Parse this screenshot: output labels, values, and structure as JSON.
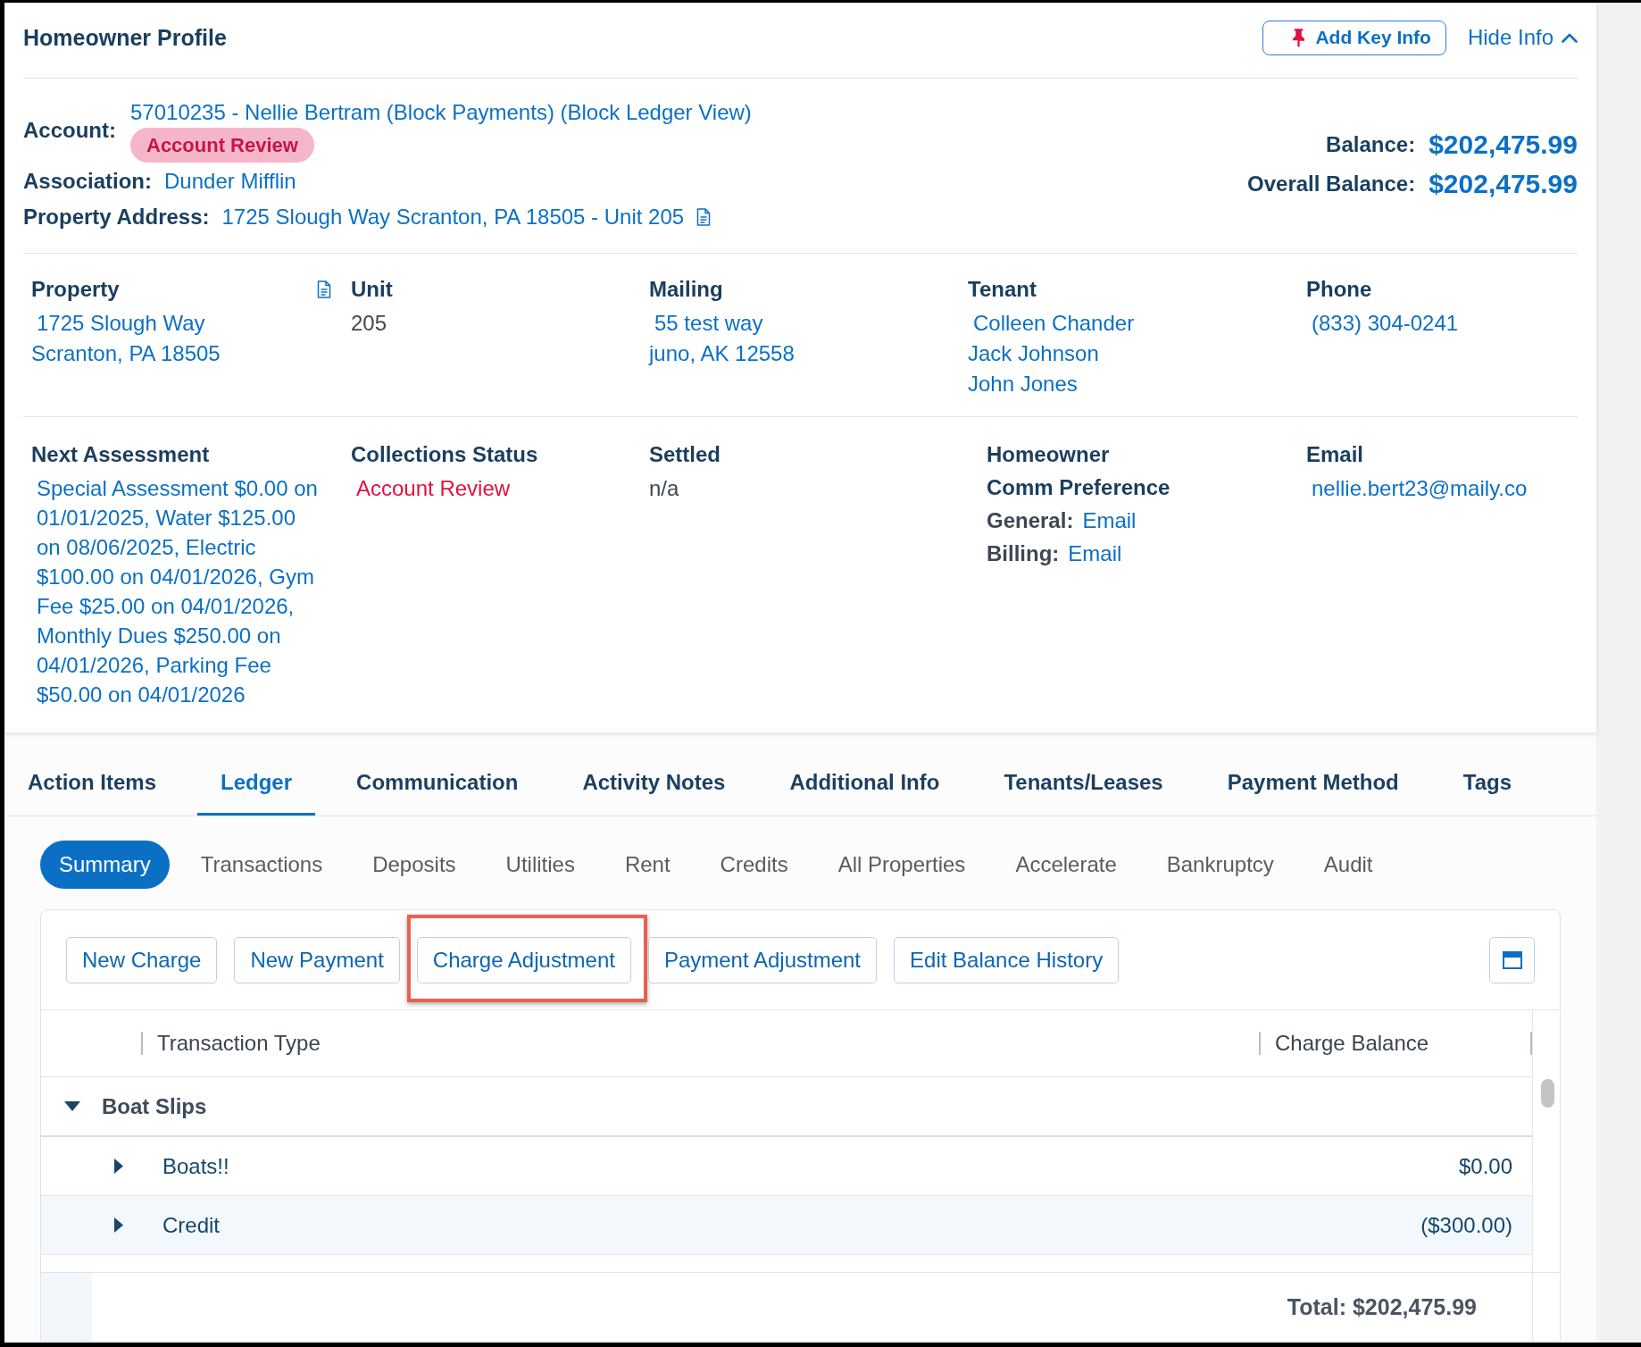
{
  "profile": {
    "title": "Homeowner Profile",
    "add_key_info": "Add Key Info",
    "hide_info": "Hide Info",
    "account": {
      "label": "Account:",
      "value": "57010235 - Nellie Bertram (Block Payments) (Block Ledger View)",
      "badge": "Account Review"
    },
    "association": {
      "label": "Association:",
      "value": "Dunder Mifflin"
    },
    "property_address": {
      "label": "Property Address:",
      "value": "1725 Slough Way Scranton, PA 18505 - Unit 205"
    },
    "balances": [
      {
        "label": "Balance:",
        "value": "$202,475.99"
      },
      {
        "label": "Overall Balance:",
        "value": "$202,475.99"
      }
    ]
  },
  "details": [
    [
      {
        "kind": "link",
        "heading": "Property",
        "document": true,
        "lines": [
          "1725 Slough Way",
          "Scranton, PA 18505"
        ]
      },
      {
        "kind": "text",
        "heading": "Unit",
        "document": false,
        "lines": [
          "205"
        ]
      },
      {
        "kind": "link",
        "heading": "Mailing",
        "document": false,
        "lines": [
          "55 test way",
          "juno, AK 12558"
        ]
      },
      {
        "kind": "link",
        "heading": "Tenant",
        "document": false,
        "lines": [
          "Colleen Chander",
          "Jack Johnson",
          "John Jones"
        ]
      },
      {
        "kind": "link",
        "heading": "Phone",
        "document": false,
        "lines": [
          "(833) 304-0241"
        ]
      }
    ],
    [
      {
        "kind": "link",
        "heading": "Next Assessment",
        "document": false,
        "lines": [
          "Special Assessment $0.00 on 01/01/2025, Water $125.00 on 08/06/2025, Electric $100.00 on 04/01/2026, Gym Fee $25.00 on 04/01/2026, Monthly Dues $250.00 on 04/01/2026, Parking Fee $50.00 on 04/01/2026"
        ]
      },
      {
        "kind": "status",
        "heading": "Collections Status",
        "document": false,
        "lines": [
          "Account Review"
        ]
      },
      {
        "kind": "text",
        "heading": "Settled",
        "document": false,
        "lines": [
          "n/a"
        ]
      },
      {
        "kind": "preference",
        "heading": "Homeowner",
        "subheading": "Comm Preference",
        "document": false,
        "preferences": [
          {
            "label": "General:",
            "value": "Email"
          },
          {
            "label": "Billing:",
            "value": "Email"
          }
        ]
      },
      {
        "kind": "link",
        "heading": "Email",
        "document": false,
        "lines": [
          "nellie.bert23@maily.co"
        ]
      }
    ]
  ],
  "tabs": [
    {
      "label": "Action Items",
      "selected": false
    },
    {
      "label": "Ledger",
      "selected": true
    },
    {
      "label": "Communication",
      "selected": false
    },
    {
      "label": "Activity Notes",
      "selected": false
    },
    {
      "label": "Additional Info",
      "selected": false
    },
    {
      "label": "Tenants/Leases",
      "selected": false
    },
    {
      "label": "Payment Method",
      "selected": false
    },
    {
      "label": "Tags",
      "selected": false
    }
  ],
  "subtabs": [
    {
      "label": "Summary",
      "selected": true
    },
    {
      "label": "Transactions",
      "selected": false
    },
    {
      "label": "Deposits",
      "selected": false
    },
    {
      "label": "Utilities",
      "selected": false
    },
    {
      "label": "Rent",
      "selected": false
    },
    {
      "label": "Credits",
      "selected": false
    },
    {
      "label": "All Properties",
      "selected": false
    },
    {
      "label": "Accelerate",
      "selected": false
    },
    {
      "label": "Bankruptcy",
      "selected": false
    },
    {
      "label": "Audit",
      "selected": false
    }
  ],
  "ledger": {
    "actions": [
      {
        "label": "New Charge",
        "highlighted": false
      },
      {
        "label": "New Payment",
        "highlighted": false
      },
      {
        "label": "Charge Adjustment",
        "highlighted": true
      },
      {
        "label": "Payment Adjustment",
        "highlighted": false
      },
      {
        "label": "Edit Balance History",
        "highlighted": false
      }
    ],
    "table": {
      "columns": [
        "Transaction Type",
        "Charge Balance"
      ],
      "groups": [
        {
          "name": "Boat Slips",
          "expanded": true,
          "selected": false,
          "children": [
            {
              "name": "Boats!!",
              "balance": "$0.00",
              "expanded": false,
              "selected": false
            },
            {
              "name": "Credit",
              "balance": "($300.00)",
              "expanded": false,
              "selected": true
            }
          ]
        }
      ],
      "total": "Total: $202,475.99"
    }
  }
}
